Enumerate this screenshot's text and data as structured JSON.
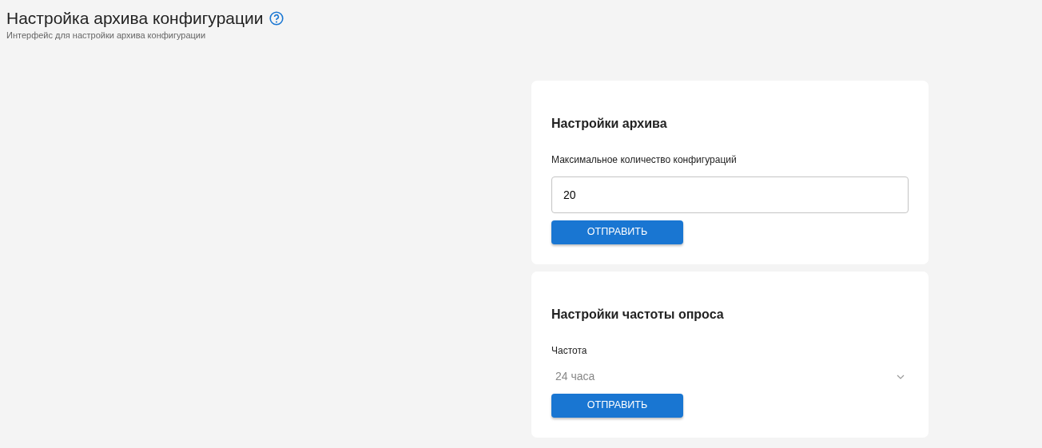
{
  "header": {
    "title": "Настройка архива конфигурации",
    "subtitle": "Интерфейс для настройки архива конфигурации"
  },
  "cards": [
    {
      "kind": "input",
      "title": "Настройки архива",
      "label": "Максимальное количество конфигураций",
      "value": "20",
      "button": "ОТПРАВИТЬ"
    },
    {
      "kind": "select",
      "title": "Настройки частоты опроса",
      "label": "Частота",
      "value": "24 часа",
      "button": "ОТПРАВИТЬ"
    }
  ]
}
